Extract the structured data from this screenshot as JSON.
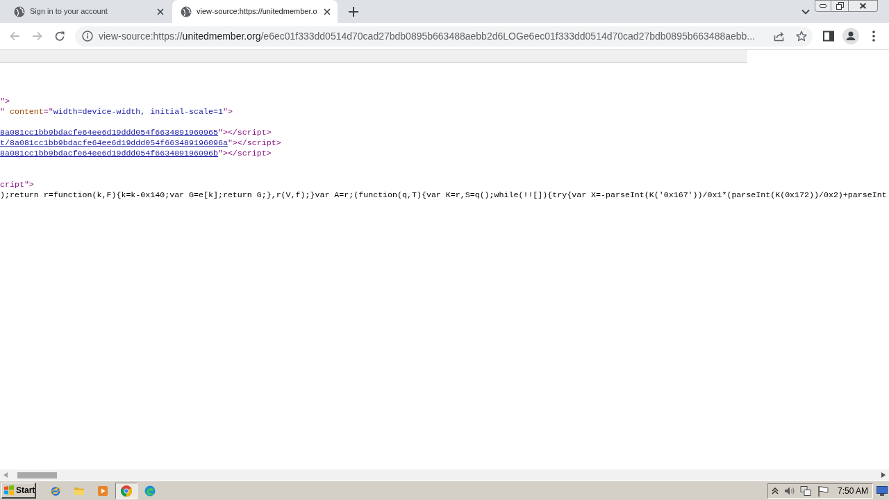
{
  "browser": {
    "tabs": [
      {
        "title": "Sign in to your account",
        "selected": false
      },
      {
        "title": "view-source:https://unitedmember.o",
        "selected": true
      }
    ],
    "nav_buttons": [
      {
        "disabled": true
      },
      {
        "disabled": true
      },
      {
        "disabled": false
      }
    ],
    "address_bar": {
      "scheme": "view-source:https://",
      "host": "unitedmember.org",
      "path": "/e6ec01f333dd0514d70cad27bdb0895b663488aebb2d6LOGe6ec01f333dd0514d70cad27bdb0895b663488aebb..."
    }
  },
  "source_blocks": [
    {
      "lines": [
        {
          "segments": [
            {
              "kind": "tag",
              "text": "\">"
            }
          ]
        },
        {
          "segments": [
            {
              "kind": "tag",
              "text": "\" "
            },
            {
              "kind": "attr",
              "text": "content"
            },
            {
              "kind": "tag",
              "text": "=\""
            },
            {
              "kind": "value",
              "text": "width=device-width, initial-scale=1"
            },
            {
              "kind": "tag",
              "text": "\">"
            }
          ]
        }
      ]
    },
    {
      "lines": [
        {
          "segments": [
            {
              "kind": "link",
              "text": "8a081cc1bb9bdacfe64ee6d19ddd054f6634891960965"
            },
            {
              "kind": "tag",
              "text": "\"></script>"
            }
          ]
        },
        {
          "segments": [
            {
              "kind": "link",
              "text": "t/8a081cc1bb9bdacfe64ee6d19ddd054f663489196096a"
            },
            {
              "kind": "tag",
              "text": "\"></script>"
            }
          ]
        },
        {
          "segments": [
            {
              "kind": "link",
              "text": "8a081cc1bb9bdacfe64ee6d19ddd054f663489196096b"
            },
            {
              "kind": "tag",
              "text": "\"></script>"
            }
          ]
        }
      ]
    },
    {
      "lines": [
        {
          "segments": [
            {
              "kind": "tag",
              "text": "cript\">"
            }
          ]
        },
        {
          "segments": [
            {
              "kind": "text",
              "text": ");return r=function(k,F){k=k-0x140;var G=e[k];return G;},r(V,f);}var A=r;(function(q,T){var K=r,S=q();while(!![]){try{var X=-parseInt(K('0x167'))/0x1*(parseInt(K(0x172))/0x2)+parseInt"
            }
          ]
        }
      ]
    }
  ],
  "taskbar": {
    "start": "Start",
    "buttons": [
      {
        "selected": false
      },
      {
        "selected": false
      },
      {
        "selected": false
      },
      {
        "selected": true
      },
      {
        "selected": false
      }
    ],
    "clock": "7:50 AM"
  }
}
